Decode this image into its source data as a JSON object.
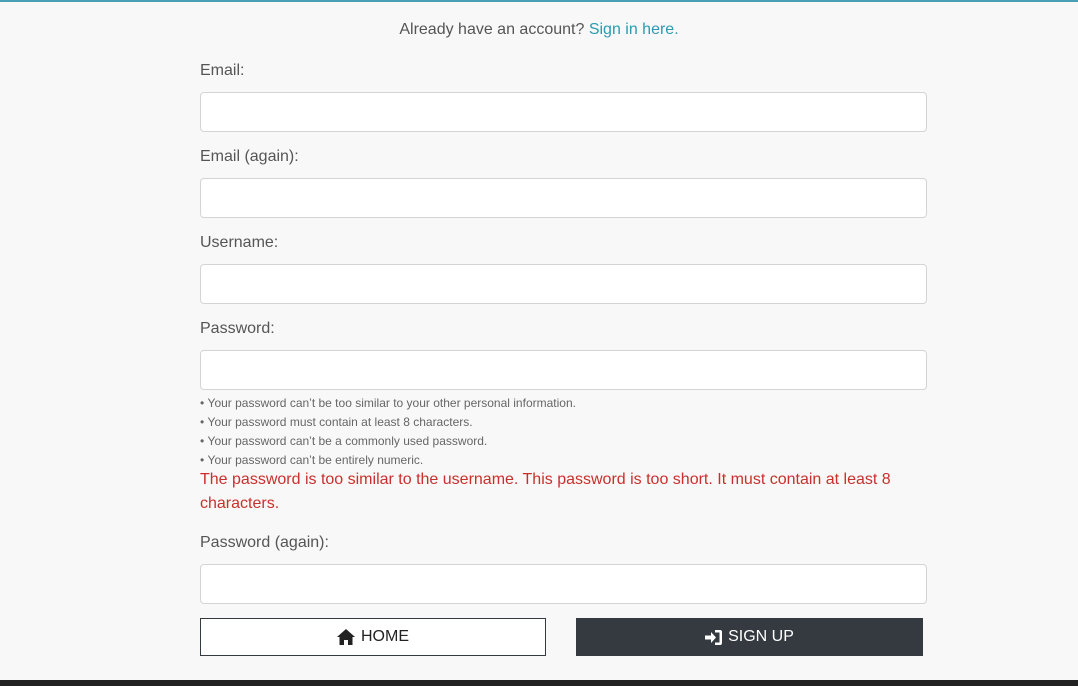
{
  "signin": {
    "prompt": "Already have an account?",
    "link_label": "Sign in here."
  },
  "fields": {
    "email": {
      "label": "Email:",
      "value": ""
    },
    "email_again": {
      "label": "Email (again):",
      "value": ""
    },
    "username": {
      "label": "Username:",
      "value": ""
    },
    "password": {
      "label": "Password:",
      "value": ""
    },
    "password_again": {
      "label": "Password (again):",
      "value": ""
    }
  },
  "password_hints": [
    "Your password can’t be too similar to your other personal information.",
    "Your password must contain at least 8 characters.",
    "Your password can’t be a commonly used password.",
    "Your password can’t be entirely numeric."
  ],
  "password_error": "The password is too similar to the username. This password is too short. It must contain at least 8 characters.",
  "buttons": {
    "home": {
      "label": "HOME",
      "icon": "home-icon"
    },
    "signup": {
      "label": "SIGN UP",
      "icon": "sign-in-icon"
    }
  },
  "colors": {
    "link": "#2a9bb0",
    "error": "#c9302c",
    "dark_button": "#343a40",
    "top_rule": "#4a9fb6"
  }
}
